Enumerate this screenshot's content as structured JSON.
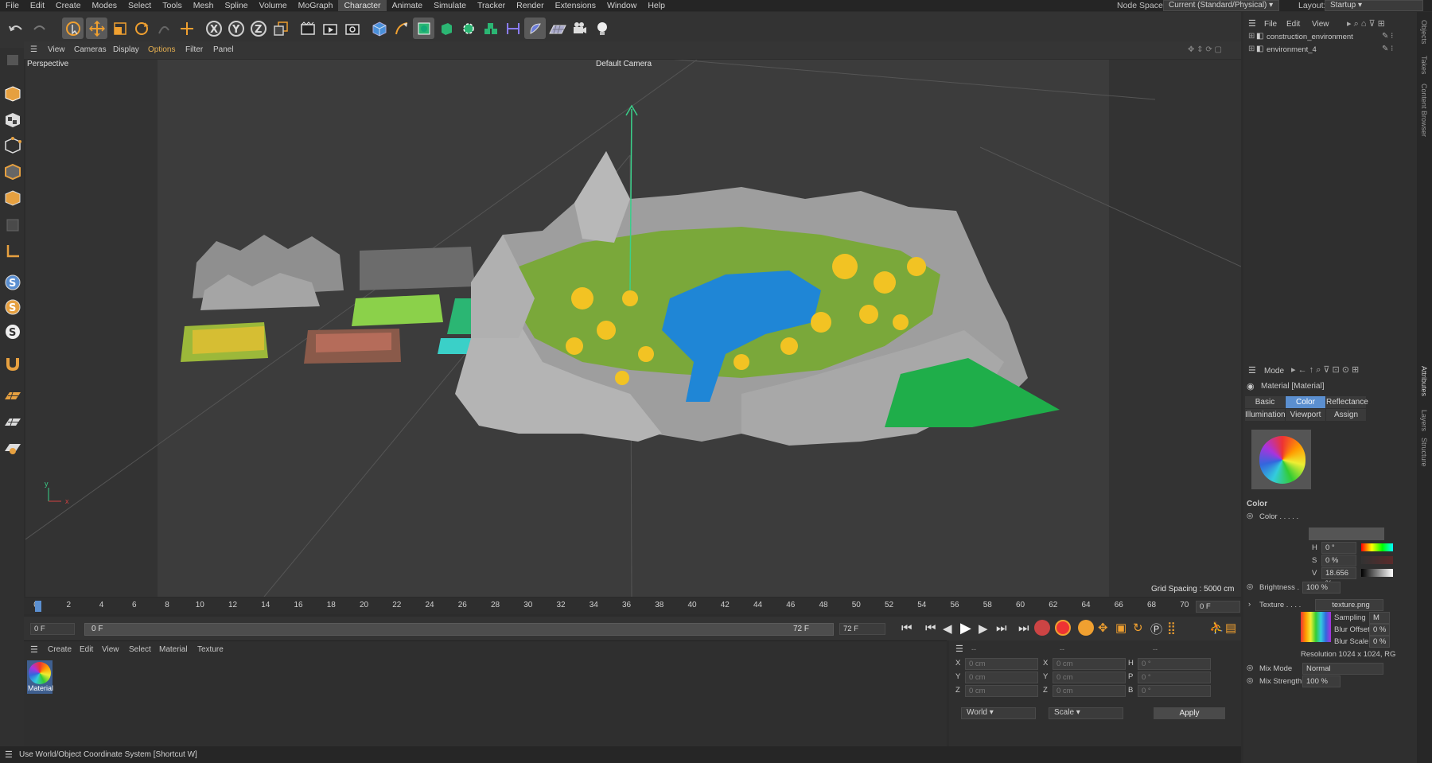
{
  "menu": [
    "File",
    "Edit",
    "Create",
    "Modes",
    "Select",
    "Tools",
    "Mesh",
    "Spline",
    "Volume",
    "MoGraph",
    "Character",
    "Animate",
    "Simulate",
    "Tracker",
    "Render",
    "Extensions",
    "Window",
    "Help"
  ],
  "menu_active": "Character",
  "node_space": {
    "label": "Node Space:",
    "value": "Current (Standard/Physical)"
  },
  "layout": {
    "label": "Layout:",
    "value": "Startup"
  },
  "viewport": {
    "menu": [
      "View",
      "Cameras",
      "Display",
      "Options",
      "Filter",
      "Panel"
    ],
    "name": "Perspective",
    "camera": "Default Camera",
    "grid_spacing": "Grid Spacing : 5000 cm",
    "axis_y": "y",
    "axis_x": "x"
  },
  "timeline": {
    "ticks": [
      "0",
      "2",
      "4",
      "6",
      "8",
      "10",
      "12",
      "14",
      "16",
      "18",
      "20",
      "22",
      "24",
      "26",
      "28",
      "30",
      "32",
      "34",
      "36",
      "38",
      "40",
      "42",
      "44",
      "46",
      "48",
      "50",
      "52",
      "54",
      "56",
      "58",
      "60",
      "62",
      "64",
      "66",
      "68",
      "70",
      "72"
    ],
    "current_frame": "0 F",
    "start_field": "0 F",
    "range_start": "0 F",
    "range_end": "72 F",
    "end_field": "72 F"
  },
  "material_manager": {
    "menu": [
      "Create",
      "Edit",
      "View",
      "Select",
      "Material",
      "Texture"
    ],
    "material_name": "Material"
  },
  "coords": {
    "header_a": "--",
    "header_b": "--",
    "header_c": "--",
    "rows": [
      {
        "a": "X",
        "av": "0 cm",
        "b": "X",
        "bv": "0 cm",
        "c": "H",
        "cv": "0 °"
      },
      {
        "a": "Y",
        "av": "0 cm",
        "b": "Y",
        "bv": "0 cm",
        "c": "P",
        "cv": "0 °"
      },
      {
        "a": "Z",
        "av": "0 cm",
        "b": "Z",
        "bv": "0 cm",
        "c": "B",
        "cv": "0 °"
      }
    ],
    "world": "World",
    "scale": "Scale",
    "apply": "Apply"
  },
  "status": "Use World/Object Coordinate System [Shortcut W]",
  "objects": {
    "menu": [
      "File",
      "Edit",
      "View"
    ],
    "items": [
      "construction_environment",
      "environment_4"
    ]
  },
  "attributes": {
    "mode": "Mode",
    "title": "Material [Material]",
    "tabs_row1": [
      "Basic",
      "Color",
      "Reflectance"
    ],
    "tabs_row2": [
      "Illumination",
      "Viewport",
      "Assign"
    ],
    "active_tab": "Color",
    "section": "Color",
    "color_label": "Color . . . . .",
    "h_label": "H",
    "h_value": "0 °",
    "s_label": "S",
    "s_value": "0 %",
    "v_label": "V",
    "v_value": "18.656 %",
    "brightness_label": "Brightness .",
    "brightness_value": "100 %",
    "texture_label": "Texture . . . .",
    "texture_value": "texture.png",
    "sampling": "Sampling",
    "sampling_value": "M",
    "blur_offset": "Blur Offset",
    "blur_offset_value": "0 %",
    "blur_scale": "Blur Scale",
    "blur_scale_value": "0 %",
    "resolution": "Resolution 1024 x 1024, RG",
    "mix_mode_label": "Mix Mode",
    "mix_mode_value": "Normal",
    "mix_strength_label": "Mix Strength",
    "mix_strength_value": "100 %"
  },
  "side_tabs": [
    "Objects",
    "Takes",
    "Content Browser",
    "Attributes",
    "Layers",
    "Structure"
  ],
  "colors": {
    "accent": "#5b8fd0",
    "active_tool": "#f0a030",
    "water": "#1f86d6",
    "grass": "#1fae4a"
  }
}
